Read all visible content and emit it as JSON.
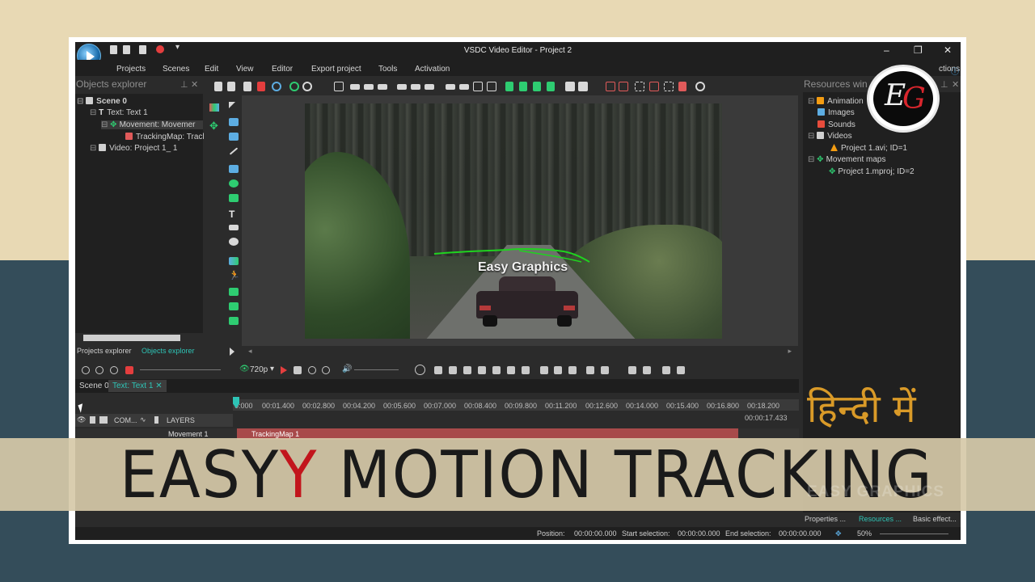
{
  "window": {
    "title": "VSDC Video Editor - Project 2",
    "controls": {
      "minimize": "–",
      "restore": "❐",
      "close": "✕"
    }
  },
  "menu": {
    "items": [
      "Projects",
      "Scenes",
      "Edit",
      "View",
      "Editor",
      "Export project",
      "Tools",
      "Activation"
    ],
    "right_label": "ctions"
  },
  "objects_explorer": {
    "title": "Objects explorer",
    "pin": "⊥",
    "close": "✕",
    "tree": [
      {
        "label": "Scene 0",
        "icon": "film-icon",
        "color": "#d0d0d0"
      },
      {
        "label": "Text: Text 1",
        "icon": "text-icon",
        "color": "#e0e0e0"
      },
      {
        "label": "Movement: Movemer",
        "icon": "move-icon",
        "color": "#2ecc71"
      },
      {
        "label": "TrackingMap: Tracl",
        "icon": "map-icon",
        "color": "#e05a5a"
      },
      {
        "label": "Video: Project 1_ 1",
        "icon": "video-icon",
        "color": "#d0d0d0"
      }
    ],
    "tabs": [
      "Projects explorer",
      "Objects explorer"
    ],
    "active_tab": 1
  },
  "resources": {
    "title": "Resources win",
    "pin": "⊥",
    "close": "✕",
    "tree": [
      {
        "label": "Animation",
        "icon": "animation-icon",
        "color": "#f39c12"
      },
      {
        "label": "Images",
        "icon": "image-icon",
        "color": "#5dade2"
      },
      {
        "label": "Sounds",
        "icon": "sound-icon",
        "color": "#e74c3c"
      },
      {
        "label": "Videos",
        "icon": "video-icon",
        "color": "#d0d0d0"
      },
      {
        "label": "Project 1.avi; ID=1",
        "icon": "cone-icon",
        "color": "#f39c12"
      },
      {
        "label": "Movement maps",
        "icon": "move-icon",
        "color": "#2ecc71"
      },
      {
        "label": "Project 1.mproj; ID=2",
        "icon": "move-icon",
        "color": "#2ecc71"
      }
    ],
    "tabs": [
      "Properties ...",
      "Resources ...",
      "Basic effect..."
    ],
    "active_tab": 1
  },
  "video_overlay_text": "Easy Graphics",
  "player": {
    "resolution": "720p",
    "resolution_arrow": "▾"
  },
  "scenes": {
    "tabs": [
      "Scene 0",
      "Text: Text 1"
    ],
    "active": 1,
    "close_glyph": "✕"
  },
  "timeline": {
    "ticks": [
      "0:000",
      "00:01.400",
      "00:02.800",
      "00:04.200",
      "00:05.600",
      "00:07.000",
      "00:08.400",
      "00:09.800",
      "00:11.200",
      "00:12.600",
      "00:14.000",
      "00:15.400",
      "00:16.800",
      "00:18.200"
    ],
    "end_time": "00:00:17.433",
    "col_header": "COM...",
    "layers_label": "LAYERS",
    "track_label": "Movement 1",
    "clip_label": "TrackingMap 1"
  },
  "status": {
    "position_label": "Position:",
    "position": "00:00:00.000",
    "start_label": "Start selection:",
    "start": "00:00:00.000",
    "end_label": "End selection:",
    "end": "00:00:00.000",
    "zoom": "50%"
  },
  "overlay": {
    "banner_text_a": "EASY",
    "banner_text_y": "Y",
    "banner_text_b": " MOTION TRACKING",
    "hindi": "हिन्दी में",
    "logo_e": "E",
    "logo_g": "G",
    "watermark": "EASY GRAPHICS"
  }
}
